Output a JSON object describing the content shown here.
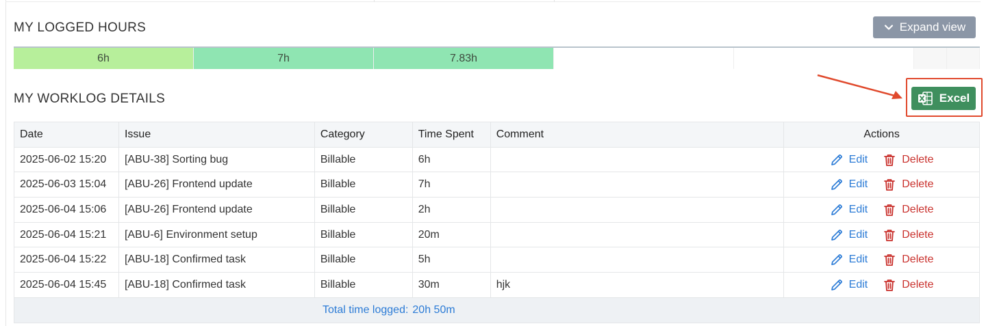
{
  "logged_hours": {
    "title": "MY LOGGED HOURS",
    "expand_label": "Expand view",
    "cells": [
      {
        "label": "6h",
        "color": "#b7ef9b"
      },
      {
        "label": "7h",
        "color": "#8fe5b2"
      },
      {
        "label": "7.83h",
        "color": "#8fe5b2"
      },
      {
        "label": "",
        "color": "#ffffff"
      },
      {
        "label": "",
        "color": "#ffffff"
      },
      {
        "label": "",
        "color": "#f7f7f7"
      },
      {
        "label": "",
        "color": "#f7f7f7"
      }
    ]
  },
  "worklog": {
    "title": "MY WORKLOG DETAILS",
    "excel_label": "Excel",
    "columns": [
      "Date",
      "Issue",
      "Category",
      "Time Spent",
      "Comment",
      "Actions"
    ],
    "rows": [
      {
        "date": "2025-06-02 15:20",
        "issue": "[ABU-38] Sorting bug",
        "category": "Billable",
        "time": "6h",
        "comment": ""
      },
      {
        "date": "2025-06-03 15:04",
        "issue": "[ABU-26] Frontend update",
        "category": "Billable",
        "time": "7h",
        "comment": ""
      },
      {
        "date": "2025-06-04 15:06",
        "issue": "[ABU-26] Frontend update",
        "category": "Billable",
        "time": "2h",
        "comment": ""
      },
      {
        "date": "2025-06-04 15:21",
        "issue": "[ABU-6] Environment setup",
        "category": "Billable",
        "time": "20m",
        "comment": ""
      },
      {
        "date": "2025-06-04 15:22",
        "issue": "[ABU-18] Confirmed task",
        "category": "Billable",
        "time": "5h",
        "comment": ""
      },
      {
        "date": "2025-06-04 15:45",
        "issue": "[ABU-18] Confirmed task",
        "category": "Billable",
        "time": "30m",
        "comment": "hjk"
      }
    ],
    "edit_label": "Edit",
    "delete_label": "Delete",
    "total_label": "Total time logged:",
    "total_value": "20h 50m"
  },
  "colors": {
    "accent_blue": "#2b7bd6",
    "danger_red": "#c9302c",
    "excel_green": "#3f8f5e",
    "highlight_red": "#e0492c"
  }
}
